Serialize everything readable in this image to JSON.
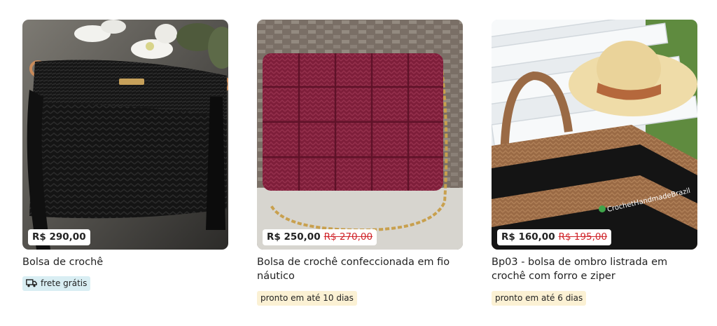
{
  "products": [
    {
      "title": "Bolsa de crochê",
      "price": "R$ 290,00",
      "price_old": "",
      "badge": "frete grátis",
      "badge_icon": "truck-icon"
    },
    {
      "title": "Bolsa de crochê confeccionada em fio náutico",
      "price": "R$ 250,00",
      "price_old": "R$ 270,00",
      "badge": "pronto em até 10 dias"
    },
    {
      "title": "Bp03 - bolsa de ombro listrada em crochê com forro e ziper",
      "price": "R$ 160,00",
      "price_old": "R$ 195,00",
      "badge": "pronto em até 6 dias",
      "watermark": "CrochetHandmadeBrazil"
    }
  ],
  "colors": {
    "old_price": "#d0252b",
    "free_shipping_badge": "#d9eef3",
    "ready_badge": "#fbf1d4"
  }
}
